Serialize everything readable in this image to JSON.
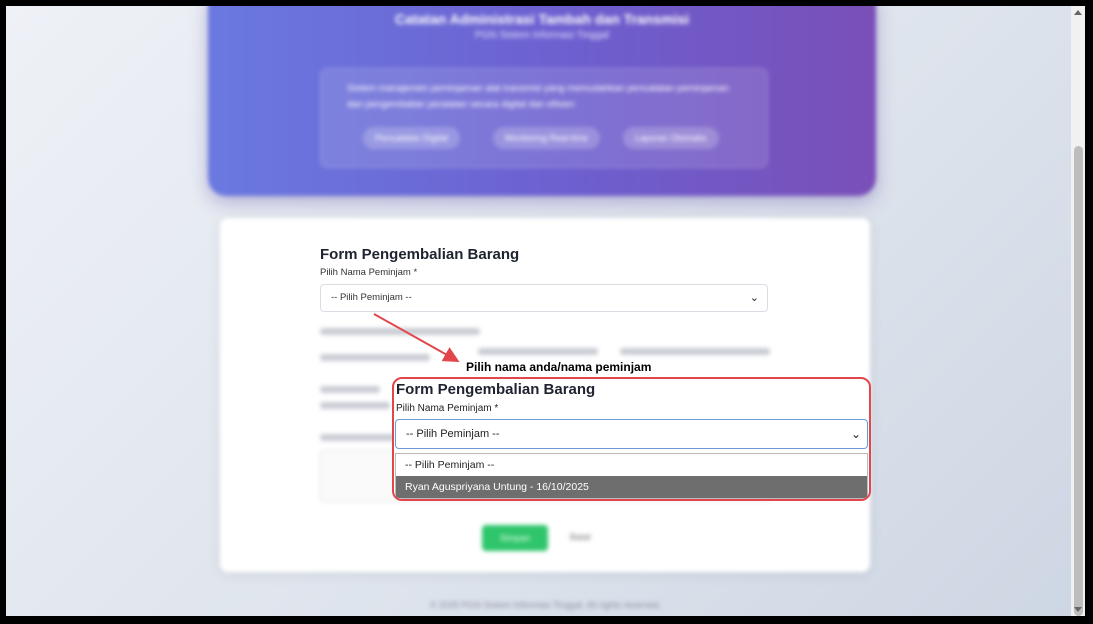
{
  "hero": {
    "title": "Catatan Administrasi Tambah dan Transmisi",
    "subtitle": "PGN Sistem Informasi Tinggal",
    "notice": "Sistem manajemen peminjaman alat transmisi yang memudahkan pencatatan peminjaman dan pengembalian peralatan secara digital dan efisien",
    "chips": [
      "Pencatatan Digital",
      "Monitoring Real-time",
      "Laporan Otomatis"
    ]
  },
  "form": {
    "title": "Form Pengembalian Barang",
    "borrower_label": "Pilih Nama Peminjam *",
    "borrower_placeholder": "-- Pilih Peminjam --",
    "condition_label": "Kondisi Barang Saat Dikembalikan *",
    "submit_label": "Simpan",
    "reset_label": "Batal"
  },
  "annotation": {
    "text": "Pilih nama anda/nama peminjam"
  },
  "zoom": {
    "title": "Form Pengembalian Barang",
    "borrower_label": "Pilih Nama Peminjam *",
    "select_value": "-- Pilih Peminjam --",
    "options": [
      "-- Pilih Peminjam --",
      "Ryan Aguspriyana Untung - 16/10/2025"
    ],
    "selected_index": 1
  },
  "footer": {
    "text": "© 2025 PGN Sistem Informasi Tinggal. All rights reserved."
  },
  "colors": {
    "hero_start": "#6a79e0",
    "hero_end": "#7a4fb8",
    "submit": "#2fc56b",
    "highlight_border": "#e0464b",
    "arrow": "#e0464b"
  }
}
